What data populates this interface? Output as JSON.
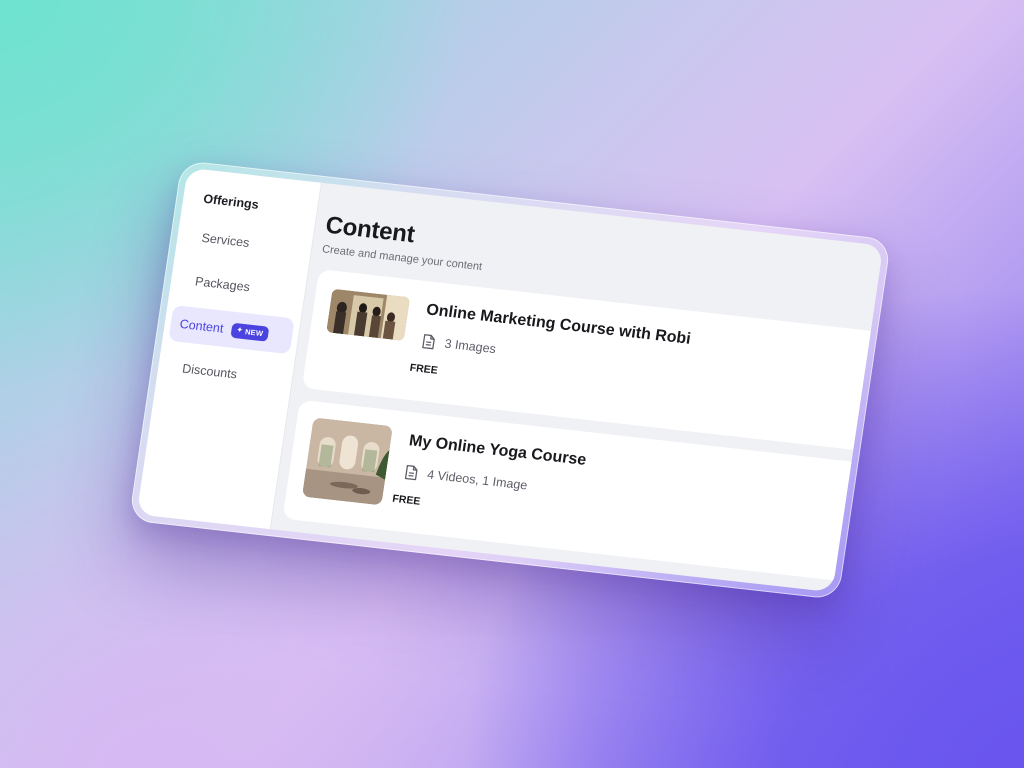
{
  "sidebar": {
    "heading": "Offerings",
    "items": [
      {
        "label": "Services",
        "icon": "none"
      },
      {
        "label": "Packages",
        "icon": "none"
      },
      {
        "label": "Content",
        "active": true,
        "badge": "NEW",
        "badge_icon": "sparkle-icon"
      },
      {
        "label": "Discounts",
        "icon": "none"
      }
    ]
  },
  "main": {
    "title": "Content",
    "subtitle": "Create and manage your content",
    "cards": [
      {
        "title": "Online Marketing Course with Robi",
        "meta": "3 Images",
        "meta_icon": "file-icon",
        "price": "FREE"
      },
      {
        "title": "My Online Yoga Course",
        "meta": "4 Videos, 1 Image",
        "meta_icon": "file-icon",
        "price": "FREE"
      }
    ]
  },
  "colors": {
    "accent": "#4b43e0",
    "active_bg": "#e8e7fd",
    "content_bg": "#f0f1f4",
    "card_bg": "#ffffff"
  }
}
